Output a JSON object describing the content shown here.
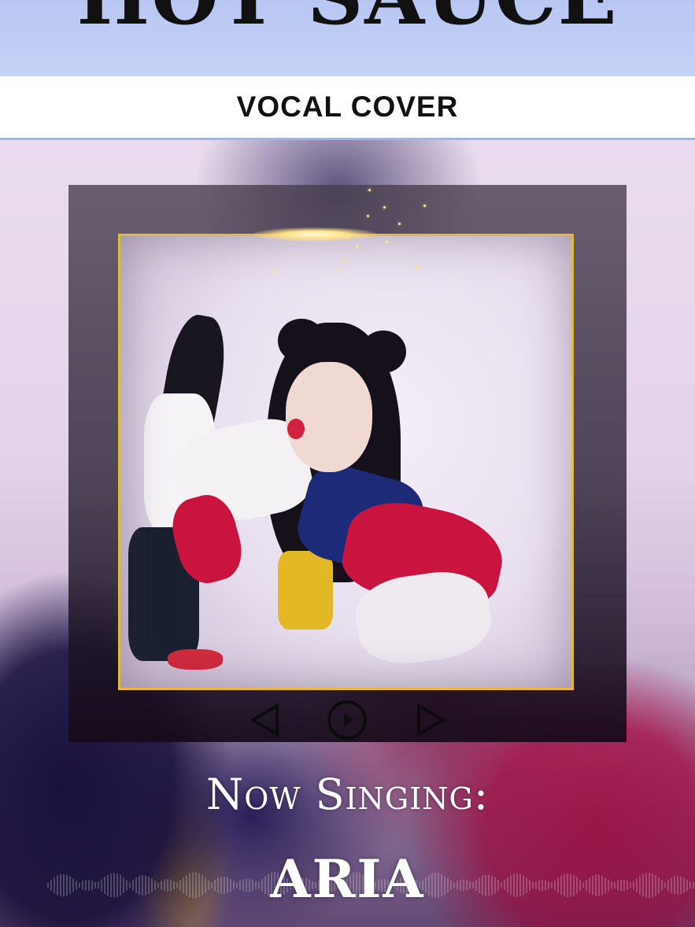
{
  "header": {
    "title": "HOT SAUCE",
    "subtitle": "VOCAL COVER"
  },
  "player": {
    "controls": {
      "prev_icon": "triangle-left-icon",
      "play_icon": "play-circle-icon",
      "next_icon": "triangle-right-icon"
    },
    "frame_color": "#e7b83c"
  },
  "caption": {
    "now_singing": "Now Singing:",
    "singer": "ARIA"
  },
  "colors": {
    "accent_gold": "#e7b83c",
    "header_band": "#c4d2f7",
    "text_dark": "#111111",
    "text_light": "#ffffff"
  }
}
